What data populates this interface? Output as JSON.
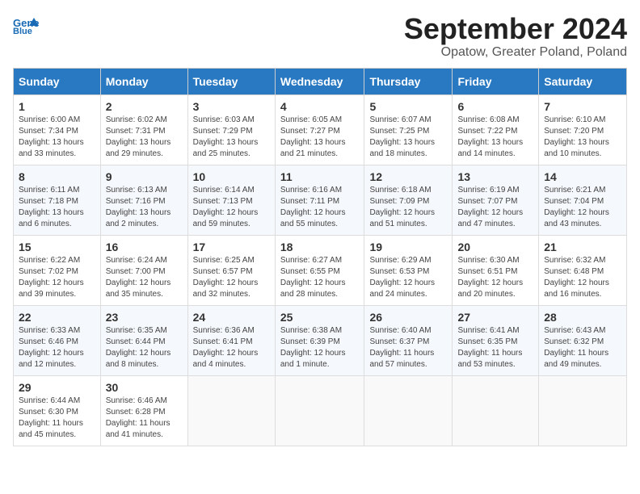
{
  "logo": {
    "line1": "General",
    "line2": "Blue"
  },
  "title": "September 2024",
  "subtitle": "Opatow, Greater Poland, Poland",
  "days_of_week": [
    "Sunday",
    "Monday",
    "Tuesday",
    "Wednesday",
    "Thursday",
    "Friday",
    "Saturday"
  ],
  "weeks": [
    [
      {
        "day": "1",
        "info": "Sunrise: 6:00 AM\nSunset: 7:34 PM\nDaylight: 13 hours\nand 33 minutes."
      },
      {
        "day": "2",
        "info": "Sunrise: 6:02 AM\nSunset: 7:31 PM\nDaylight: 13 hours\nand 29 minutes."
      },
      {
        "day": "3",
        "info": "Sunrise: 6:03 AM\nSunset: 7:29 PM\nDaylight: 13 hours\nand 25 minutes."
      },
      {
        "day": "4",
        "info": "Sunrise: 6:05 AM\nSunset: 7:27 PM\nDaylight: 13 hours\nand 21 minutes."
      },
      {
        "day": "5",
        "info": "Sunrise: 6:07 AM\nSunset: 7:25 PM\nDaylight: 13 hours\nand 18 minutes."
      },
      {
        "day": "6",
        "info": "Sunrise: 6:08 AM\nSunset: 7:22 PM\nDaylight: 13 hours\nand 14 minutes."
      },
      {
        "day": "7",
        "info": "Sunrise: 6:10 AM\nSunset: 7:20 PM\nDaylight: 13 hours\nand 10 minutes."
      }
    ],
    [
      {
        "day": "8",
        "info": "Sunrise: 6:11 AM\nSunset: 7:18 PM\nDaylight: 13 hours\nand 6 minutes."
      },
      {
        "day": "9",
        "info": "Sunrise: 6:13 AM\nSunset: 7:16 PM\nDaylight: 13 hours\nand 2 minutes."
      },
      {
        "day": "10",
        "info": "Sunrise: 6:14 AM\nSunset: 7:13 PM\nDaylight: 12 hours\nand 59 minutes."
      },
      {
        "day": "11",
        "info": "Sunrise: 6:16 AM\nSunset: 7:11 PM\nDaylight: 12 hours\nand 55 minutes."
      },
      {
        "day": "12",
        "info": "Sunrise: 6:18 AM\nSunset: 7:09 PM\nDaylight: 12 hours\nand 51 minutes."
      },
      {
        "day": "13",
        "info": "Sunrise: 6:19 AM\nSunset: 7:07 PM\nDaylight: 12 hours\nand 47 minutes."
      },
      {
        "day": "14",
        "info": "Sunrise: 6:21 AM\nSunset: 7:04 PM\nDaylight: 12 hours\nand 43 minutes."
      }
    ],
    [
      {
        "day": "15",
        "info": "Sunrise: 6:22 AM\nSunset: 7:02 PM\nDaylight: 12 hours\nand 39 minutes."
      },
      {
        "day": "16",
        "info": "Sunrise: 6:24 AM\nSunset: 7:00 PM\nDaylight: 12 hours\nand 35 minutes."
      },
      {
        "day": "17",
        "info": "Sunrise: 6:25 AM\nSunset: 6:57 PM\nDaylight: 12 hours\nand 32 minutes."
      },
      {
        "day": "18",
        "info": "Sunrise: 6:27 AM\nSunset: 6:55 PM\nDaylight: 12 hours\nand 28 minutes."
      },
      {
        "day": "19",
        "info": "Sunrise: 6:29 AM\nSunset: 6:53 PM\nDaylight: 12 hours\nand 24 minutes."
      },
      {
        "day": "20",
        "info": "Sunrise: 6:30 AM\nSunset: 6:51 PM\nDaylight: 12 hours\nand 20 minutes."
      },
      {
        "day": "21",
        "info": "Sunrise: 6:32 AM\nSunset: 6:48 PM\nDaylight: 12 hours\nand 16 minutes."
      }
    ],
    [
      {
        "day": "22",
        "info": "Sunrise: 6:33 AM\nSunset: 6:46 PM\nDaylight: 12 hours\nand 12 minutes."
      },
      {
        "day": "23",
        "info": "Sunrise: 6:35 AM\nSunset: 6:44 PM\nDaylight: 12 hours\nand 8 minutes."
      },
      {
        "day": "24",
        "info": "Sunrise: 6:36 AM\nSunset: 6:41 PM\nDaylight: 12 hours\nand 4 minutes."
      },
      {
        "day": "25",
        "info": "Sunrise: 6:38 AM\nSunset: 6:39 PM\nDaylight: 12 hours\nand 1 minute."
      },
      {
        "day": "26",
        "info": "Sunrise: 6:40 AM\nSunset: 6:37 PM\nDaylight: 11 hours\nand 57 minutes."
      },
      {
        "day": "27",
        "info": "Sunrise: 6:41 AM\nSunset: 6:35 PM\nDaylight: 11 hours\nand 53 minutes."
      },
      {
        "day": "28",
        "info": "Sunrise: 6:43 AM\nSunset: 6:32 PM\nDaylight: 11 hours\nand 49 minutes."
      }
    ],
    [
      {
        "day": "29",
        "info": "Sunrise: 6:44 AM\nSunset: 6:30 PM\nDaylight: 11 hours\nand 45 minutes."
      },
      {
        "day": "30",
        "info": "Sunrise: 6:46 AM\nSunset: 6:28 PM\nDaylight: 11 hours\nand 41 minutes."
      },
      null,
      null,
      null,
      null,
      null
    ]
  ]
}
